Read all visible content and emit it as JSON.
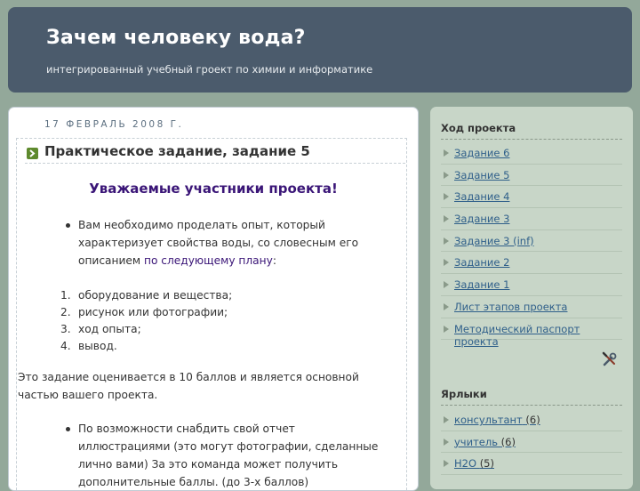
{
  "header": {
    "title": "Зачем человеку вода?",
    "description": "интегрированный учебный гроект по химии и информатике"
  },
  "post": {
    "date": "17 ФЕВРАЛЬ 2008 Г.",
    "title": "Практическое задание, задание 5",
    "headline": "Уважаемые участники проекта!",
    "intro_text": "Вам необходимо проделать опыт, который характеризует свойства воды, со словесным его описанием ",
    "intro_link": "по следующему плану",
    "intro_end": ":",
    "steps": [
      {
        "num": "1.",
        "text": "оборудование и вещества;"
      },
      {
        "num": "2.",
        "text": "рисунок или фотографии;"
      },
      {
        "num": "3.",
        "text": "ход опыта;"
      },
      {
        "num": "4.",
        "text": "вывод."
      }
    ],
    "scoring_text": "Это задание оценивается в 10 баллов и является основной частью вашего проекта.",
    "bonus_text": "По возможности снабдить свой отчет иллюстрациями (это могут фотографии, сделанные лично вами) За это команда может получить дополнительные баллы. (до 3-х баллов)"
  },
  "sidebar": {
    "progress_heading": "Ход проекта",
    "progress_links": [
      "Задание 6",
      "Задание 5",
      "Задание 4",
      "Задание 3",
      "Задание 3 (inf)",
      "Задание 2",
      "Задание 1",
      "Лист этапов проекта",
      "Методический паспорт проекта"
    ],
    "labels_heading": "Ярлыки",
    "labels": [
      {
        "name": "консультант",
        "count": "(6)"
      },
      {
        "name": "учитель",
        "count": "(6)"
      },
      {
        "name": "H2O",
        "count": "(5)"
      }
    ]
  },
  "colors": {
    "page_background": "#93a89a",
    "header_background": "#4b5b6c",
    "sidebar_background": "#c8d6c8",
    "link": "#2f5f8a",
    "headline": "#3a1577",
    "post_arrow": "#5e8a2d"
  },
  "icons": [
    "post-arrow-icon",
    "sidebar-arrow-icon",
    "tools-icon"
  ]
}
